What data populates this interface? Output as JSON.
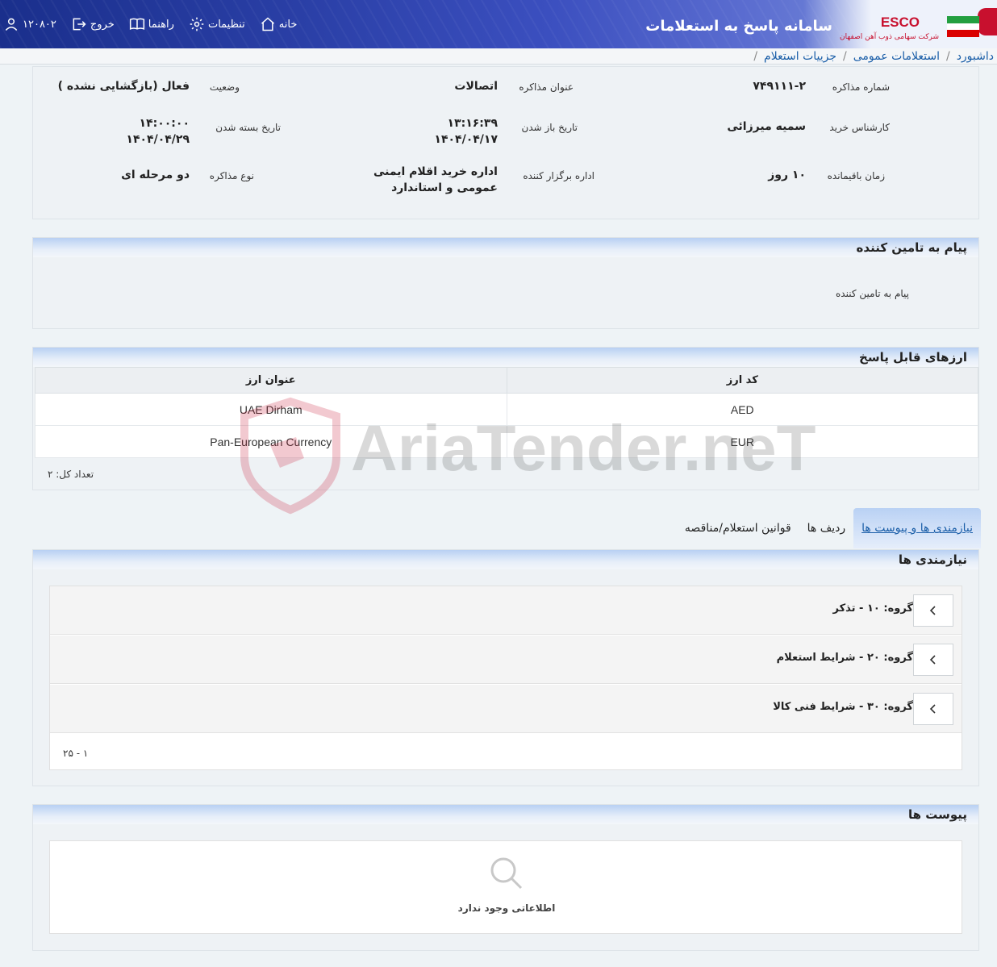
{
  "header": {
    "app_title": "سامانه پاسخ به استعلامات",
    "brand": "ESCO",
    "brand_sub": "شرکت سهامی ذوب آهن اصفهان",
    "nav": {
      "home": "خانه",
      "settings": "تنظیمات",
      "guide": "راهنما",
      "logout": "خروج",
      "user_id": "۱۲۰۸۰۲"
    }
  },
  "breadcrumb": [
    "داشبورد",
    "استعلامات عمومی",
    "جزییات استعلام"
  ],
  "details": {
    "number_label": "شماره مذاکره",
    "number_value": "۷۴۹۱۱۱-۲",
    "title_label": "عنوان مذاکره",
    "title_value": "اتصالات",
    "status_label": "وضعیت",
    "status_value": "فعال (بازگشایی نشده )",
    "buyer_label": "کارشناس خرید",
    "buyer_value": "سمیه میرزائی",
    "open_label": "تاریخ باز شدن",
    "open_time": "۱۳:۱۶:۳۹",
    "open_date": "۱۴۰۴/۰۴/۱۷",
    "close_label": "تاریخ بسته شدن",
    "close_time": "۱۴:۰۰:۰۰",
    "close_date": "۱۴۰۴/۰۴/۲۹",
    "remaining_label": "زمان باقیمانده",
    "remaining_value": "۱۰ روز",
    "org_label": "اداره برگزار کننده",
    "org_value": "اداره خرید اقلام ایمنی عمومی و استاندارد",
    "type_label": "نوع مذاکره",
    "type_value": "دو مرحله ای"
  },
  "message_panel": {
    "title": "پیام به تامین کننده",
    "label": "پیام به تامین کننده"
  },
  "currency_panel": {
    "title": "ارزهای قابل پاسخ",
    "columns": [
      "کد ارز",
      "عنوان ارز"
    ],
    "rows": [
      {
        "code": "AED",
        "name": "UAE Dirham"
      },
      {
        "code": "EUR",
        "name": "Pan-European Currency"
      }
    ],
    "total": "تعداد کل: ۲"
  },
  "tabs": [
    "نیازمندی ها و پیوست ها",
    "ردیف ها",
    "قوانین استعلام/مناقصه"
  ],
  "requirements": {
    "title": "نیازمندی ها",
    "groups": [
      "گروه: ۱۰ - تذکر",
      "گروه: ۲۰ - شرایط استعلام",
      "گروه: ۳۰ - شرایط فنی کالا"
    ],
    "pager": "۱ - ۲۵"
  },
  "attachments": {
    "title": "پیوست ها",
    "empty": "اطلاعاتی وجود ندارد"
  },
  "watermark": "AriaTender.neT",
  "colors": {
    "header_blue": "#2a3fa6",
    "link_blue": "#1a5ea8",
    "brand_red": "#c8102e"
  }
}
